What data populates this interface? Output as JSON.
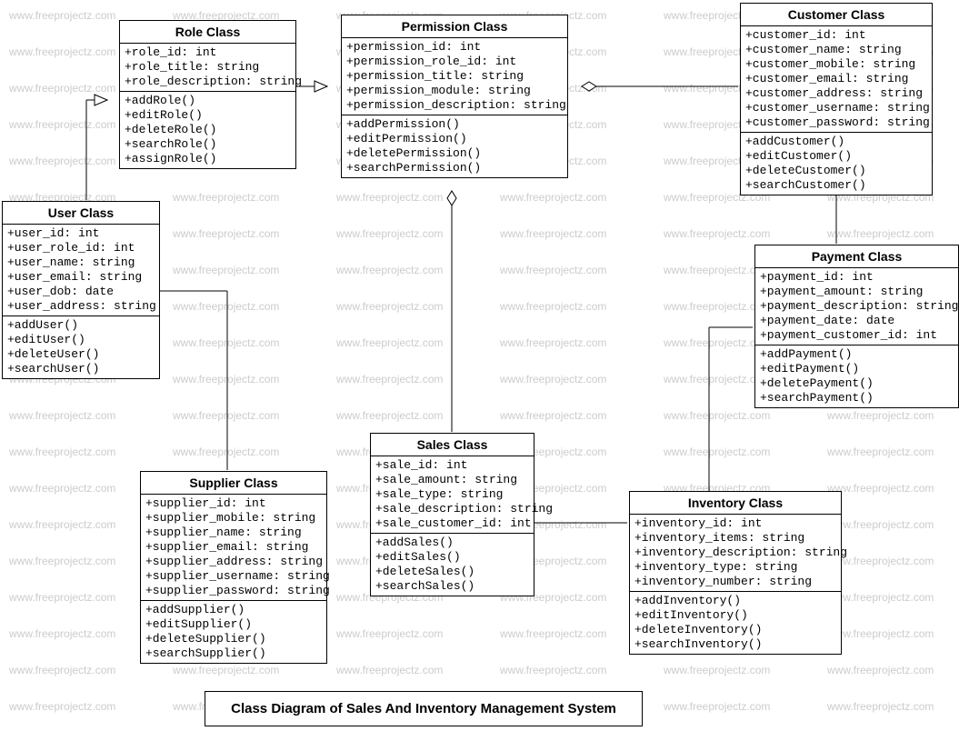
{
  "watermark_text": "www.freeprojectz.com",
  "caption": "Class Diagram of Sales And Inventory Management System",
  "classes": {
    "role": {
      "title": "Role Class",
      "attributes": [
        "+role_id: int",
        "+role_title: string",
        "+role_description: string"
      ],
      "methods": [
        "+addRole()",
        "+editRole()",
        "+deleteRole()",
        "+searchRole()",
        "+assignRole()"
      ]
    },
    "permission": {
      "title": "Permission Class",
      "attributes": [
        "+permission_id: int",
        "+permission_role_id: int",
        "+permission_title: string",
        "+permission_module: string",
        "+permission_description: string"
      ],
      "methods": [
        "+addPermission()",
        "+editPermission()",
        "+deletePermission()",
        "+searchPermission()"
      ]
    },
    "customer": {
      "title": "Customer Class",
      "attributes": [
        "+customer_id: int",
        "+customer_name: string",
        "+customer_mobile: string",
        "+customer_email: string",
        "+customer_address: string",
        "+customer_username: string",
        "+customer_password: string"
      ],
      "methods": [
        "+addCustomer()",
        "+editCustomer()",
        "+deleteCustomer()",
        "+searchCustomer()"
      ]
    },
    "user": {
      "title": "User Class",
      "attributes": [
        "+user_id: int",
        "+user_role_id: int",
        "+user_name: string",
        "+user_email: string",
        "+user_dob: date",
        "+user_address: string"
      ],
      "methods": [
        "+addUser()",
        "+editUser()",
        "+deleteUser()",
        "+searchUser()"
      ]
    },
    "payment": {
      "title": "Payment Class",
      "attributes": [
        "+payment_id: int",
        "+payment_amount: string",
        "+payment_description: string",
        "+payment_date: date",
        "+payment_customer_id: int"
      ],
      "methods": [
        "+addPayment()",
        "+editPayment()",
        "+deletePayment()",
        "+searchPayment()"
      ]
    },
    "sales": {
      "title": "Sales Class",
      "attributes": [
        "+sale_id: int",
        "+sale_amount: string",
        "+sale_type: string",
        "+sale_description: string",
        "+sale_customer_id: int"
      ],
      "methods": [
        "+addSales()",
        "+editSales()",
        "+deleteSales()",
        "+searchSales()"
      ]
    },
    "supplier": {
      "title": "Supplier Class",
      "attributes": [
        "+supplier_id: int",
        "+supplier_mobile: string",
        "+supplier_name: string",
        "+supplier_email: string",
        "+supplier_address: string",
        "+supplier_username: string",
        "+supplier_password: string"
      ],
      "methods": [
        "+addSupplier()",
        "+editSupplier()",
        "+deleteSupplier()",
        "+searchSupplier()"
      ]
    },
    "inventory": {
      "title": "Inventory Class",
      "attributes": [
        "+inventory_id: int",
        "+inventory_items: string",
        "+inventory_description: string",
        "+inventory_type: string",
        "+inventory_number: string"
      ],
      "methods": [
        "+addInventory()",
        "+editInventory()",
        "+deleteInventory()",
        "+searchInventory()"
      ]
    }
  }
}
